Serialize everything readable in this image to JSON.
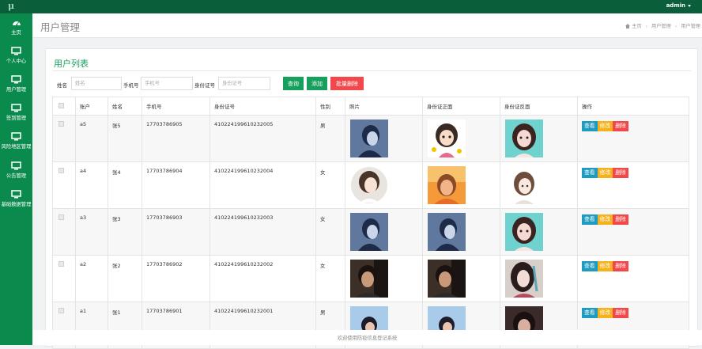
{
  "topbar": {
    "logo": "μ",
    "user": "admin"
  },
  "sidebar": {
    "items": [
      {
        "label": "主页",
        "icon": "dashboard-icon"
      },
      {
        "label": "个人中心",
        "icon": "monitor-icon"
      },
      {
        "label": "用户管理",
        "icon": "monitor-icon"
      },
      {
        "label": "签到管理",
        "icon": "monitor-icon"
      },
      {
        "label": "风险地区管理",
        "icon": "monitor-icon"
      },
      {
        "label": "公告管理",
        "icon": "monitor-icon"
      },
      {
        "label": "基础数据管理",
        "icon": "monitor-icon"
      }
    ]
  },
  "header": {
    "title": "用户管理",
    "breadcrumb": [
      "主页",
      "用户管理",
      "用户管理"
    ]
  },
  "card": {
    "title": "用户列表"
  },
  "search": {
    "name_label": "姓名",
    "name_placeholder": "姓名",
    "phone_label": "手机号",
    "phone_placeholder": "手机号",
    "idcard_label": "身份证号",
    "idcard_placeholder": "身份证号",
    "query_button": "查询",
    "add_button": "添加",
    "batch_delete_button": "批量删除"
  },
  "table": {
    "columns": [
      "账户",
      "姓名",
      "手机号",
      "身份证号",
      "性别",
      "照片",
      "身份证正面",
      "身份证反面",
      "操作"
    ],
    "rows": [
      {
        "account": "a5",
        "name": "张5",
        "phone": "17703786905",
        "idcard": "410224199610232005",
        "gender": "男",
        "images": [
          "boy-portrait",
          "cartoon-girl",
          "cartoon-girl-teal"
        ]
      },
      {
        "account": "a4",
        "name": "张4",
        "phone": "17703786904",
        "idcard": "410224199610232004",
        "gender": "女",
        "images": [
          "girl-circle",
          "girl-sunset",
          "sketch-girl"
        ]
      },
      {
        "account": "a3",
        "name": "张3",
        "phone": "17703786903",
        "idcard": "410224199610232003",
        "gender": "女",
        "images": [
          "boy-portrait",
          "boy-portrait",
          "cartoon-girl-teal"
        ]
      },
      {
        "account": "a2",
        "name": "张2",
        "phone": "17703786902",
        "idcard": "410224199610232002",
        "gender": "女",
        "images": [
          "dark-photo-boy",
          "dark-photo-boy",
          "anime-girl-dark"
        ]
      },
      {
        "account": "a1",
        "name": "张1",
        "phone": "17703786901",
        "idcard": "410224199610232001",
        "gender": "男",
        "images": [
          "sky-boy",
          "sky-boy",
          "dark-portrait"
        ]
      }
    ],
    "actions": {
      "view": "查看",
      "edit": "修改",
      "delete": "删除"
    }
  },
  "footer": {
    "text": "欢迎使用防疫信息登记系统"
  },
  "colors": {
    "topbar": "#0b5e3a",
    "sidebar": "#0b8a4e",
    "accent": "#1aa160",
    "danger": "#f2484b",
    "warning": "#f5b21c",
    "info": "#1f9bc0"
  }
}
